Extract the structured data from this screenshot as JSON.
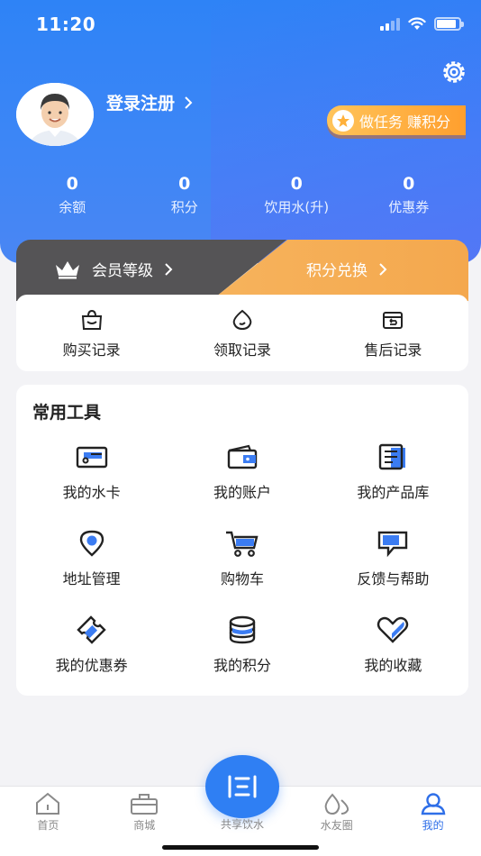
{
  "status_bar": {
    "time": "11:20"
  },
  "profile": {
    "login_label": "登录注册",
    "task_button": "做任务 赚积分"
  },
  "stats": [
    {
      "value": "0",
      "label": "余额"
    },
    {
      "value": "0",
      "label": "积分"
    },
    {
      "value": "0",
      "label": "饮用水(升)"
    },
    {
      "value": "0",
      "label": "优惠券"
    }
  ],
  "banner": {
    "vip_label": "会员等级",
    "exchange_label": "积分兑换"
  },
  "records": [
    {
      "label": "购买记录",
      "icon": "shopping-bag-icon"
    },
    {
      "label": "领取记录",
      "icon": "water-drop-icon"
    },
    {
      "label": "售后记录",
      "icon": "return-box-icon"
    }
  ],
  "tools": {
    "title": "常用工具",
    "items": [
      {
        "label": "我的水卡",
        "icon": "water-card-icon"
      },
      {
        "label": "我的账户",
        "icon": "wallet-icon"
      },
      {
        "label": "我的产品库",
        "icon": "product-list-icon"
      },
      {
        "label": "地址管理",
        "icon": "location-pin-icon"
      },
      {
        "label": "购物车",
        "icon": "cart-icon"
      },
      {
        "label": "反馈与帮助",
        "icon": "feedback-icon"
      },
      {
        "label": "我的优惠券",
        "icon": "coupon-icon"
      },
      {
        "label": "我的积分",
        "icon": "coin-stack-icon"
      },
      {
        "label": "我的收藏",
        "icon": "heart-icon"
      }
    ]
  },
  "tabbar": {
    "items": [
      {
        "label": "首页",
        "icon": "home-icon"
      },
      {
        "label": "商城",
        "icon": "shop-icon"
      },
      {
        "label": "共享饮水",
        "icon": "water-dispenser-icon"
      },
      {
        "label": "水友圈",
        "icon": "community-icon"
      },
      {
        "label": "我的",
        "icon": "user-icon"
      }
    ],
    "active": "我的"
  },
  "colors": {
    "primary": "#2f7ff3",
    "accent_orange": "#f4a84e",
    "vip_gray": "#555456"
  }
}
